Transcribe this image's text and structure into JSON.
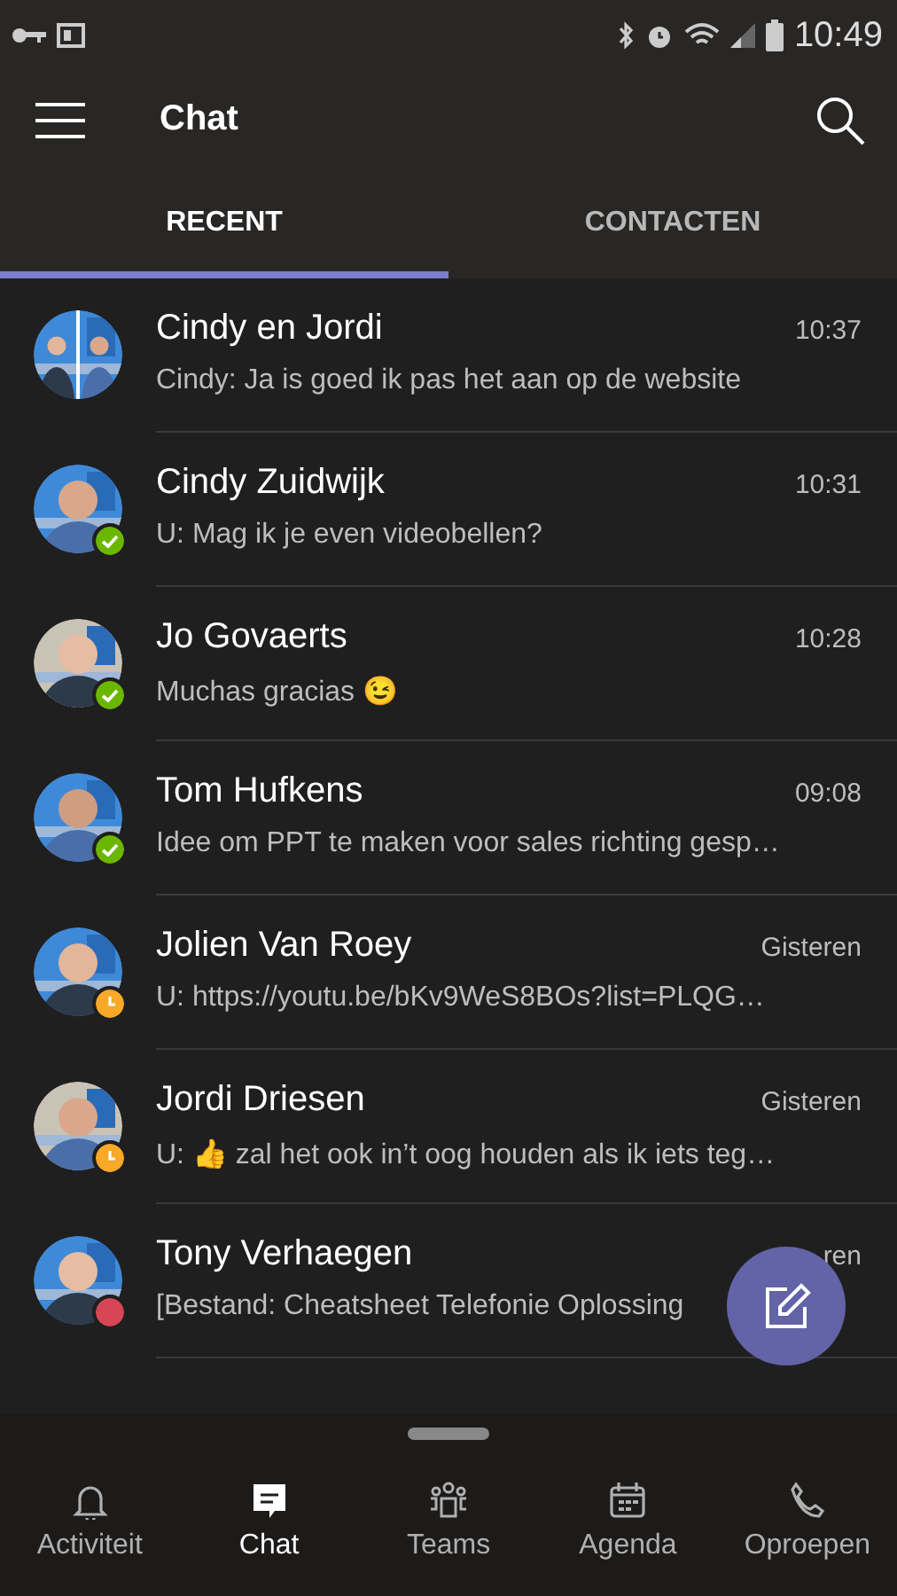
{
  "status_bar": {
    "time": "10:49"
  },
  "header": {
    "title": "Chat"
  },
  "tabs": [
    {
      "label": "RECENT",
      "selected": true
    },
    {
      "label": "CONTACTEN",
      "selected": false
    }
  ],
  "chats": [
    {
      "name": "Cindy en Jordi",
      "time": "10:37",
      "preview": "Cindy: Ja is goed ik pas het aan op de website",
      "kind": "group"
    },
    {
      "name": "Cindy Zuidwijk",
      "time": "10:31",
      "preview": "U: Mag ik je even videobellen?",
      "kind": "available"
    },
    {
      "name": "Jo Govaerts",
      "time": "10:28",
      "preview": "Muchas gracias 😉",
      "kind": "available"
    },
    {
      "name": "Tom Hufkens",
      "time": "09:08",
      "preview": "Idee om PPT te maken voor sales richting gesp…",
      "kind": "available"
    },
    {
      "name": "Jolien Van Roey",
      "time": "Gisteren",
      "preview": "U: https://youtu.be/bKv9WeS8BOs?list=PLQG…",
      "kind": "away"
    },
    {
      "name": "Jordi Driesen",
      "time": "Gisteren",
      "preview": "U: 👍 zal het ook in’t oog houden als ik iets teg…",
      "kind": "away"
    },
    {
      "name": "Tony Verhaegen",
      "time": "ren",
      "preview": "[Bestand: Cheatsheet Telefonie Oplossing",
      "kind": "busy"
    }
  ],
  "nav": [
    {
      "label": "Activiteit",
      "kind": "bell",
      "selected": false
    },
    {
      "label": "Chat",
      "kind": "chat",
      "selected": true
    },
    {
      "label": "Teams",
      "kind": "teams",
      "selected": false
    },
    {
      "label": "Agenda",
      "kind": "calendar",
      "selected": false
    },
    {
      "label": "Oproepen",
      "kind": "phone",
      "selected": false
    }
  ]
}
